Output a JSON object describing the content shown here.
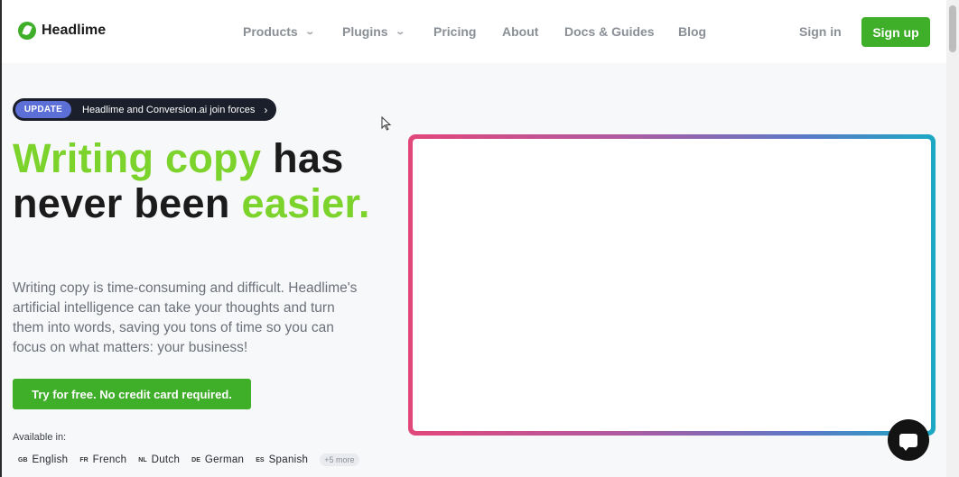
{
  "header": {
    "logo_text": "Headlime",
    "nav": [
      {
        "label": "Products",
        "dropdown": true
      },
      {
        "label": "Plugins",
        "dropdown": true
      },
      {
        "label": "Pricing",
        "dropdown": false
      },
      {
        "label": "About",
        "dropdown": false
      },
      {
        "label": "Docs & Guides",
        "dropdown": false
      },
      {
        "label": "Blog",
        "dropdown": false
      }
    ],
    "sign_in": "Sign in",
    "sign_up": "Sign up"
  },
  "announcement": {
    "badge": "UPDATE",
    "text": "Headlime and Conversion.ai join forces",
    "arrow": "›"
  },
  "hero": {
    "headline_green_1": "Writing copy",
    "headline_dark": "has never been",
    "headline_green_2": "easier.",
    "description": "Writing copy is time-consuming and difficult. Headlime's artificial intelligence can take your thoughts and turn them into words, saving you tons of time so you can focus on what matters: your business!",
    "cta": "Try for free. No credit card required.",
    "available_label": "Available in:",
    "languages": [
      {
        "code": "GB",
        "name": "English"
      },
      {
        "code": "FR",
        "name": "French"
      },
      {
        "code": "NL",
        "name": "Dutch"
      },
      {
        "code": "DE",
        "name": "German"
      },
      {
        "code": "ES",
        "name": "Spanish"
      }
    ],
    "more_languages": "+5 more"
  },
  "colors": {
    "brand_green": "#3fae29",
    "headline_green": "#7bd32b",
    "update_badge": "#5b6fd6"
  },
  "icons": {
    "logo": "headlime-leaf-icon",
    "chat": "chat-bubble-icon",
    "chevron": "chevron-down-icon"
  }
}
